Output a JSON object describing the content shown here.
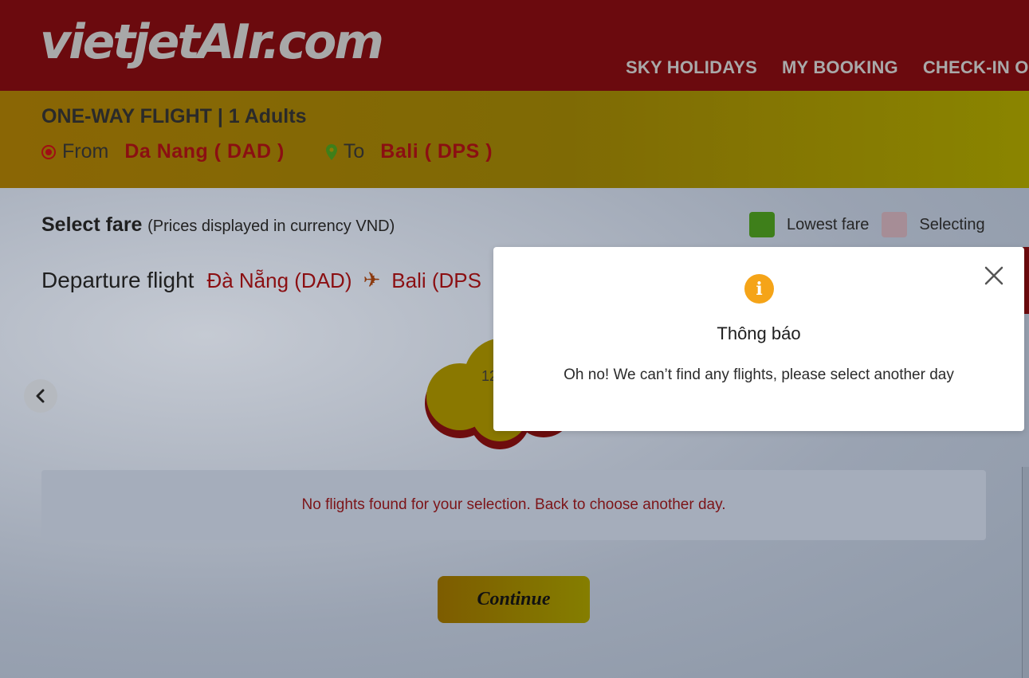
{
  "header": {
    "logo_text_main": "vietjet",
    "logo_text_air": "AIr",
    "logo_text_domain": ".com",
    "nav": [
      {
        "label": "SKY HOLIDAYS"
      },
      {
        "label": "MY BOOKING"
      },
      {
        "label": "CHECK-IN O"
      }
    ]
  },
  "trip": {
    "type_label": "ONE-WAY FLIGHT | 1 Adults",
    "from_label": "From",
    "from_value": "Da Nang ( DAD )",
    "to_label": "To",
    "to_value": "Bali ( DPS )"
  },
  "fare": {
    "title": "Select fare",
    "note": "(Prices displayed in currency VND)",
    "legend_lowest": "Lowest fare",
    "legend_selecting": "Selecting"
  },
  "departure": {
    "title": "Departure flight",
    "origin": "Đà Nẵng (DAD)",
    "destination": "Bali (DPS",
    "date_partial": "12"
  },
  "results": {
    "empty_message": "No flights found for your selection. Back to choose another day."
  },
  "actions": {
    "continue_label": "Continue"
  },
  "modal": {
    "title": "Thông báo",
    "message": "Oh no! We can’t find any flights, please select another day",
    "info_glyph": "i"
  },
  "colors": {
    "brand_red": "#6b0a0e",
    "accent_yellow": "#857e00",
    "info_orange": "#f5a418",
    "text_red": "#8b0f12"
  }
}
